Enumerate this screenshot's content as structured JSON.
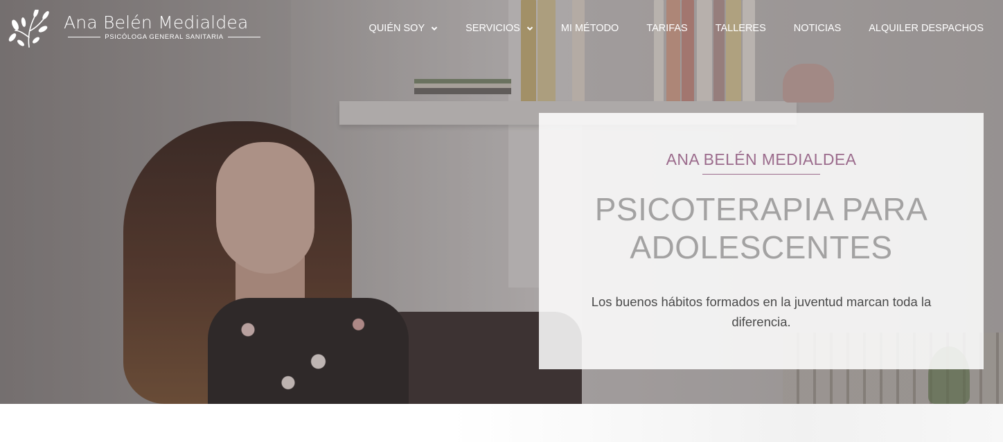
{
  "header": {
    "logo_name": "Ana Belén Medialdea",
    "logo_subtitle": "PSICÓLOGA GENERAL SANITARIA",
    "logo_icon": "olive-branch-icon"
  },
  "nav": {
    "items": [
      {
        "label": "QUIÉN SOY",
        "has_dropdown": true
      },
      {
        "label": "SERVICIOS",
        "has_dropdown": true
      },
      {
        "label": "MI MÉTODO",
        "has_dropdown": false
      },
      {
        "label": "TARIFAS",
        "has_dropdown": false
      },
      {
        "label": "TALLERES",
        "has_dropdown": false
      },
      {
        "label": "NOTICIAS",
        "has_dropdown": false
      },
      {
        "label": "ALQUILER DESPACHOS",
        "has_dropdown": false
      }
    ]
  },
  "hero": {
    "kicker": "ANA BELÉN MEDIALDEA",
    "title": "PSICOTERAPIA PARA ADOLESCENTES",
    "text": "Los buenos hábitos formados en la juventud marcan toda la diferencia."
  },
  "colors": {
    "accent": "#9b6b8c",
    "title": "#a3a2a2",
    "body_text": "#4a4a4a"
  }
}
